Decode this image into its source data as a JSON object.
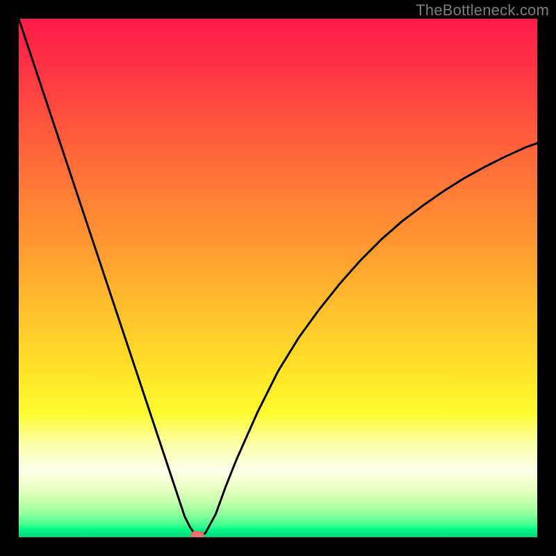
{
  "watermark": "TheBottleneck.com",
  "chart_data": {
    "type": "line",
    "title": "",
    "xlabel": "",
    "ylabel": "",
    "xlim": [
      0,
      100
    ],
    "ylim": [
      0,
      100
    ],
    "x": [
      0,
      2,
      4,
      6,
      8,
      10,
      12,
      14,
      16,
      18,
      20,
      22,
      24,
      26,
      28,
      30,
      31,
      32,
      33,
      34,
      35,
      36,
      38,
      40,
      42,
      44,
      46,
      48,
      50,
      54,
      58,
      62,
      66,
      70,
      74,
      78,
      82,
      86,
      90,
      94,
      98,
      100
    ],
    "values": [
      100.0,
      94.0,
      88.0,
      82.0,
      76.0,
      70.0,
      64.0,
      58.0,
      52.0,
      46.0,
      40.0,
      34.0,
      28.0,
      22.0,
      16.0,
      10.0,
      7.0,
      4.0,
      2.0,
      0.5,
      0.3,
      0.8,
      4.5,
      10.0,
      15.0,
      19.5,
      24.0,
      28.0,
      32.0,
      38.5,
      44.0,
      49.0,
      53.5,
      57.5,
      61.0,
      64.0,
      66.8,
      69.3,
      71.5,
      73.5,
      75.3,
      76.0
    ],
    "marker": {
      "x": 34.5,
      "y": 0.3
    },
    "gradient_colors": {
      "top": "#ff1b4b",
      "mid_upper": "#ff9433",
      "mid": "#ffe329",
      "mid_lower": "#fdffe9",
      "bottom": "#04d679"
    },
    "curve_color": "#000000",
    "background_color": "#000000"
  }
}
